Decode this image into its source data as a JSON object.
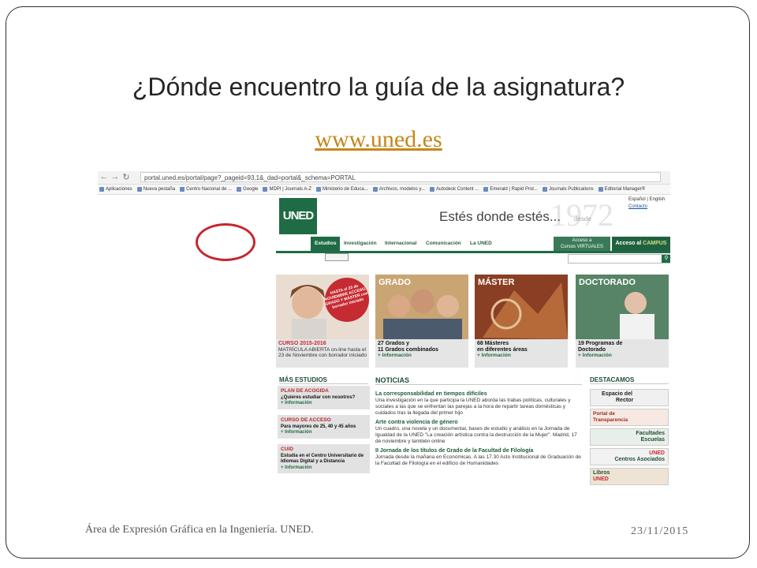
{
  "slide": {
    "title": "¿Dónde encuentro la guía de la asignatura?",
    "link": "www.uned.es",
    "footer_left": "Área de Expresión Gráfica en la Ingeniería. UNED.",
    "footer_right": "23/11/2015"
  },
  "browser": {
    "url": "portal.uned.es/portal/page?_pageid=93,1&_dad=portal&_schema=PORTAL",
    "bookmarks": [
      "Aplicaciones",
      "Nueva pestaña",
      "Centro Nacional de ...",
      "Google",
      "MDPI | Journals A-Z",
      "Ministerio de Educa...",
      "Archivos, modelos y...",
      "Autodesk Content ...",
      "Emerald | Rapid Prot...",
      "Journals Publications",
      "Editorial Manager®"
    ]
  },
  "site": {
    "logo": "UNED",
    "slogan": "Estés donde estés...",
    "slogan_small": "desde",
    "year": "1972",
    "toplinks": [
      "Español | English",
      "Contacto"
    ],
    "menu": [
      "Estudios",
      "Investigación",
      "Internacional",
      "Comunicación",
      "La UNED"
    ],
    "virtual_label": "Acceso a",
    "virtual_value": "Cursos VIRTUALES",
    "campus_label": "Acceso al",
    "campus_value": "CAMPUS",
    "tiles": [
      {
        "badge": "HASTA el 23 de NOVIEMBRE ACCESO, GRADO Y MÁSTER con borrador iniciado",
        "head": "",
        "caption_title": "CURSO 2015-2016",
        "caption_text": "MATRÍCULA ABIERTA on-line hasta el 23 de Noviembre con borrador iniciado",
        "caption_more": ""
      },
      {
        "head": "GRADO",
        "caption_title": "27 Grados y",
        "caption_text": "11 Grados combinados",
        "caption_more": "+ Información"
      },
      {
        "head": "MÁSTER",
        "caption_title": "68 Másteres",
        "caption_text": "en diferentes áreas",
        "caption_more": "+ Información"
      },
      {
        "head": "DOCTORADO",
        "caption_title": "19 Programas de",
        "caption_text": "Doctorado",
        "caption_more": "+ Información"
      }
    ],
    "mas_estudios": {
      "title": "MÁS ESTUDIOS",
      "items": [
        {
          "head": "PLAN DE ACOGIDA",
          "text": "¿Quieres estudiar con nosotros?",
          "more": "+ Información"
        },
        {
          "head": "CURSO DE ACCESO",
          "text": "Para mayores de 25, 40 y 45 años",
          "more": "+ Información"
        },
        {
          "head": "CUID",
          "text": "Estudia en el Centro Universitario de Idiomas Digital y a Distancia",
          "more": "+ Información"
        }
      ]
    },
    "noticias": {
      "title": "NOTICIAS",
      "items": [
        {
          "head": "La corresponsabilidad en tiempos difíciles",
          "text": "Una investigación en la que participa la UNED aborda las trabas políticas, culturales y sociales a las que se enfrentan las parejas a la hora de repartir tareas domésticas y cuidados tras la llegada del primer hijo"
        },
        {
          "head": "Arte contra violencia de género",
          "text": "Un cuadro, una novela y un documental, bases de estudio y análisis en la Jornada de Igualdad de la UNED \"La creación artística contra la destrucción de la Mujer\". Madrid, 17 de noviembre y también online"
        },
        {
          "head": "II Jornada de los títulos de Grado de la Facultad de Filología",
          "text": "Jornada desde la mañana en Económicas. A las 17.30 Acto Institucional de Graduación de la Facultad de Filología en el edificio de Humanidades"
        }
      ]
    },
    "destacamos": {
      "title": "DESTACAMOS",
      "items": [
        {
          "a": "Espacio del",
          "b": "Rector"
        },
        {
          "a": "Portal de",
          "b": "Transparencia"
        },
        {
          "a": "Facultades",
          "b": "Escuelas"
        },
        {
          "a": "UNED",
          "b": "Centros Asociados"
        },
        {
          "a": "Libros",
          "b": "UNED"
        }
      ]
    }
  },
  "colors": {
    "uned_green": "#1f6b45",
    "link_gold": "#c6871a",
    "highlight_red": "#c6262e"
  }
}
